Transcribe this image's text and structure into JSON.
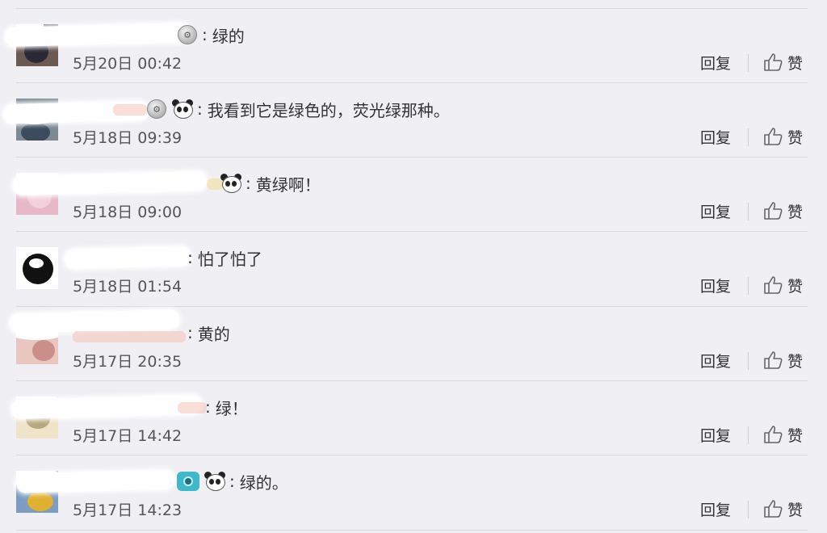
{
  "comments": [
    {
      "content": "绿的",
      "time": "5月20日 00:42",
      "emoji_before": [
        "silver-medal-badge"
      ],
      "avatar_color": "#6b5a52",
      "avatar_accent": "#2a2a36"
    },
    {
      "content": "我看到它是绿色的，荧光绿那种。",
      "time": "5月18日 09:39",
      "emoji_before": [
        "silver-medal-badge",
        "panda-emoji"
      ],
      "avatar_color": "#7c8a96",
      "avatar_accent": "#3c4c5c"
    },
    {
      "content": "黄绿啊！",
      "time": "5月18日 09:00",
      "emoji_before": [
        "panda-emoji"
      ],
      "avatar_color": "#e7b9c8",
      "avatar_accent": "#f2d0dc"
    },
    {
      "content": "怕了怕了",
      "time": "5月18日 01:54",
      "emoji_before": [],
      "avatar_color": "#ffffff",
      "avatar_accent": "#111111"
    },
    {
      "content": "黄的",
      "time": "5月17日 20:35",
      "emoji_before": [],
      "avatar_color": "#e9c7c0",
      "avatar_accent": "#c98f88"
    },
    {
      "content": "绿！",
      "time": "5月17日 14:42",
      "emoji_before": [],
      "avatar_color": "#efe3c8",
      "avatar_accent": "#b9a77e"
    },
    {
      "content": "绿的。",
      "time": "5月17日 14:23",
      "emoji_before": [
        "camera-emoji",
        "panda-emoji"
      ],
      "avatar_color": "#7d9ec2",
      "avatar_accent": "#e0b030"
    }
  ],
  "actions": {
    "reply_label": "回复",
    "like_label": "赞"
  },
  "colors": {
    "background": "#f0eff4",
    "divider": "#d8d8de",
    "text": "#333333",
    "muted": "#555555"
  }
}
